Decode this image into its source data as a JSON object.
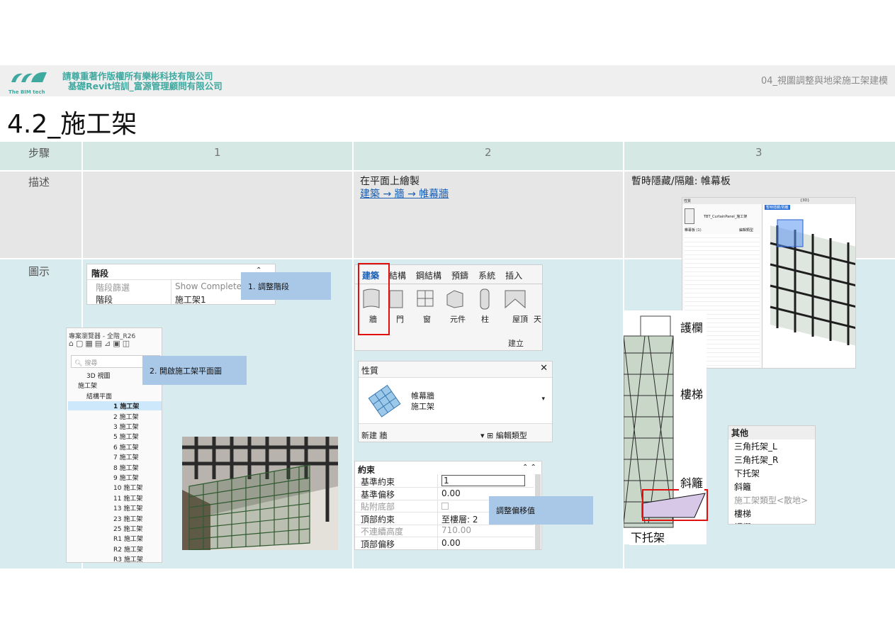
{
  "header": {
    "company_line1": "請尊重著作版權所有樂彬科技有限公司",
    "company_line2": "基礎Revit培訓_富源管理顧問有限公司",
    "logo_text": "The BIM tech",
    "chapter": "04_視圖調整與地梁施工架建模"
  },
  "page_title": "4.2_施工架",
  "table": {
    "row_labels": {
      "step": "步驟",
      "desc": "描述",
      "image": "圖示"
    },
    "steps": [
      "1",
      "2",
      "3"
    ],
    "desc2_line1": "在平面上繪製",
    "desc2_link": "建築 → 牆 → 帷幕牆",
    "desc3": "暫時隱藏/隔離: 帷幕板"
  },
  "step1": {
    "phase_panel": {
      "title": "階段",
      "row1_label": "階段篩選",
      "row1_value": "Show Complete",
      "row2_label": "階段",
      "row2_value": "施工架1"
    },
    "callout1": "1. 調整階段",
    "browser_title": "專案瀏覽器 - 全階_R26",
    "browser_search": "搜尋",
    "callout2": "2. 開啟施工架平面圖",
    "tree_items": [
      "3D 視圖",
      "施工架",
      "結構平面",
      "1 施工架",
      "2 施工架",
      "3 施工架",
      "5 施工架",
      "6 施工架",
      "7 施工架",
      "8 施工架",
      "9 施工架",
      "10 施工架",
      "11 施工架",
      "13 施工架",
      "23 施工架",
      "25 施工架",
      "R1 施工架",
      "R2 施工架",
      "R3 施工架"
    ]
  },
  "step2": {
    "ribbon_tabs": [
      "建築",
      "結構",
      "鋼結構",
      "預鑄",
      "系統",
      "插入"
    ],
    "ribbon_tools": [
      "牆",
      "門",
      "窗",
      "元件",
      "柱",
      "屋頂",
      "天"
    ],
    "ribbon_group": "建立",
    "props_title": "性質",
    "props_family": "帷幕牆",
    "props_type": "施工架",
    "props_new": "新建 牆",
    "props_edit": "編輯類型",
    "constraint_title": "約束",
    "constraints": [
      {
        "label": "基準約束",
        "value": "1"
      },
      {
        "label": "基準偏移",
        "value": "0.00"
      },
      {
        "label": "貼附底部",
        "value": ""
      },
      {
        "label": "頂部約束",
        "value": "至樓層: 2"
      },
      {
        "label": "不連續高度",
        "value": "710.00"
      },
      {
        "label": "頂部偏移",
        "value": "0.00"
      }
    ],
    "callout": "調整偏移值"
  },
  "step3": {
    "labels": [
      "護欄",
      "樓梯",
      "斜籬",
      "下托架"
    ],
    "menu_title": "其他",
    "menu_items": [
      "三角托架_L",
      "三角托架_R",
      "下托架",
      "斜籬",
      "施工架類型<散地>",
      "樓梯",
      "護欄"
    ],
    "props_tab": "性質",
    "view_tab": "{3D}",
    "panel_type": "TBT_CurtainPanel_施工架",
    "panel_count": "帷幕板 (1)",
    "panel_edit": "編輯類型",
    "temp_label": "暫時隱藏/隔離"
  }
}
